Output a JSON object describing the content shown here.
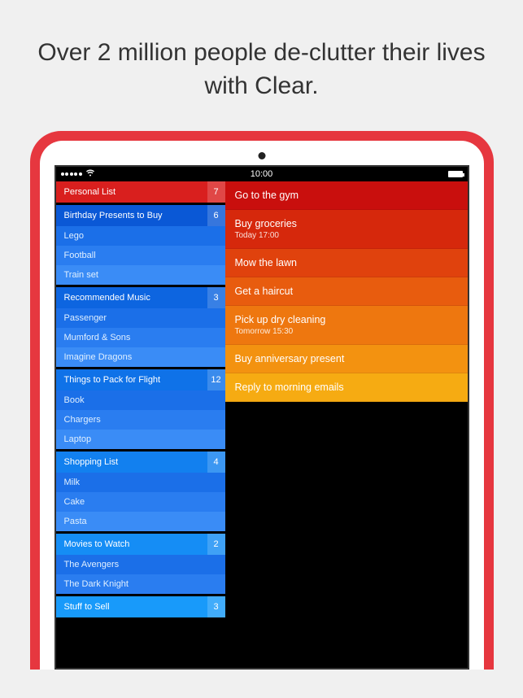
{
  "headline": "Over 2 million people de-clutter their lives with Clear.",
  "status": {
    "time": "10:00"
  },
  "sidebar": {
    "lists": [
      {
        "title": "Personal List",
        "count": "7",
        "header_class": "red",
        "items": []
      },
      {
        "title": "Birthday Presents to Buy",
        "count": "6",
        "header_class": "blue0",
        "items": [
          "Lego",
          "Football",
          "Train set"
        ]
      },
      {
        "title": "Recommended Music",
        "count": "3",
        "header_class": "blue1",
        "items": [
          "Passenger",
          "Mumford & Sons",
          "Imagine Dragons"
        ]
      },
      {
        "title": "Things to Pack for Flight",
        "count": "12",
        "header_class": "blue2",
        "items": [
          "Book",
          "Chargers",
          "Laptop"
        ]
      },
      {
        "title": "Shopping List",
        "count": "4",
        "header_class": "blue3",
        "items": [
          "Milk",
          "Cake",
          "Pasta"
        ]
      },
      {
        "title": "Movies to Watch",
        "count": "2",
        "header_class": "blue4",
        "items": [
          "The Avengers",
          "The Dark Knight"
        ]
      },
      {
        "title": "Stuff to Sell",
        "count": "3",
        "header_class": "blue5",
        "items": []
      }
    ]
  },
  "tasks": [
    {
      "title": "Go to the gym",
      "sub": ""
    },
    {
      "title": "Buy groceries",
      "sub": "Today 17:00"
    },
    {
      "title": "Mow the lawn",
      "sub": ""
    },
    {
      "title": "Get a haircut",
      "sub": ""
    },
    {
      "title": "Pick up dry cleaning",
      "sub": "Tomorrow 15:30"
    },
    {
      "title": "Buy anniversary present",
      "sub": ""
    },
    {
      "title": "Reply to morning emails",
      "sub": ""
    }
  ]
}
